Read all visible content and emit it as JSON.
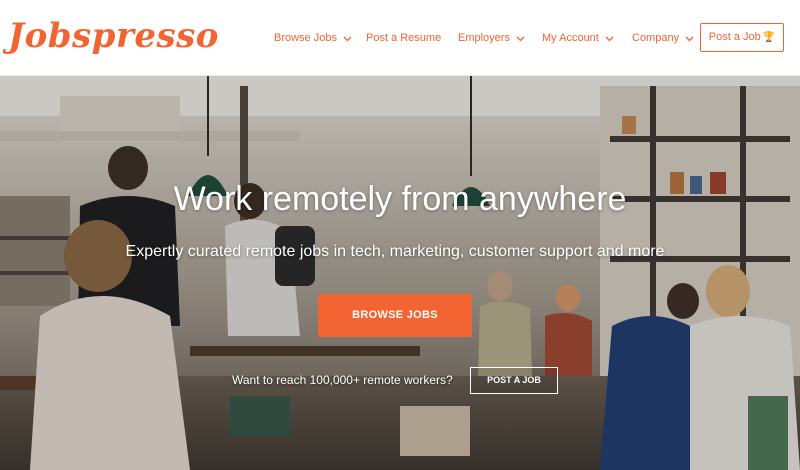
{
  "brand": {
    "logo_text": "Jobspresso",
    "accent_color": "#f26432"
  },
  "nav": {
    "items": [
      {
        "label": "Browse Jobs",
        "has_dropdown": true
      },
      {
        "label": "Post a Resume",
        "has_dropdown": false
      },
      {
        "label": "Employers",
        "has_dropdown": true
      },
      {
        "label": "My Account",
        "has_dropdown": true
      },
      {
        "label": "Company",
        "has_dropdown": true
      }
    ],
    "post_job_button": {
      "label": "Post a Job",
      "icon": "trophy-icon"
    }
  },
  "hero": {
    "title": "Work remotely from anywhere",
    "subtitle": "Expertly curated remote jobs in tech, marketing, customer support and more",
    "browse_button": "BROWSE JOBS",
    "reach_text": "Want to reach 100,000+ remote workers?",
    "post_job_cta": "POST A JOB",
    "background": "cafe-people-working-photo"
  }
}
